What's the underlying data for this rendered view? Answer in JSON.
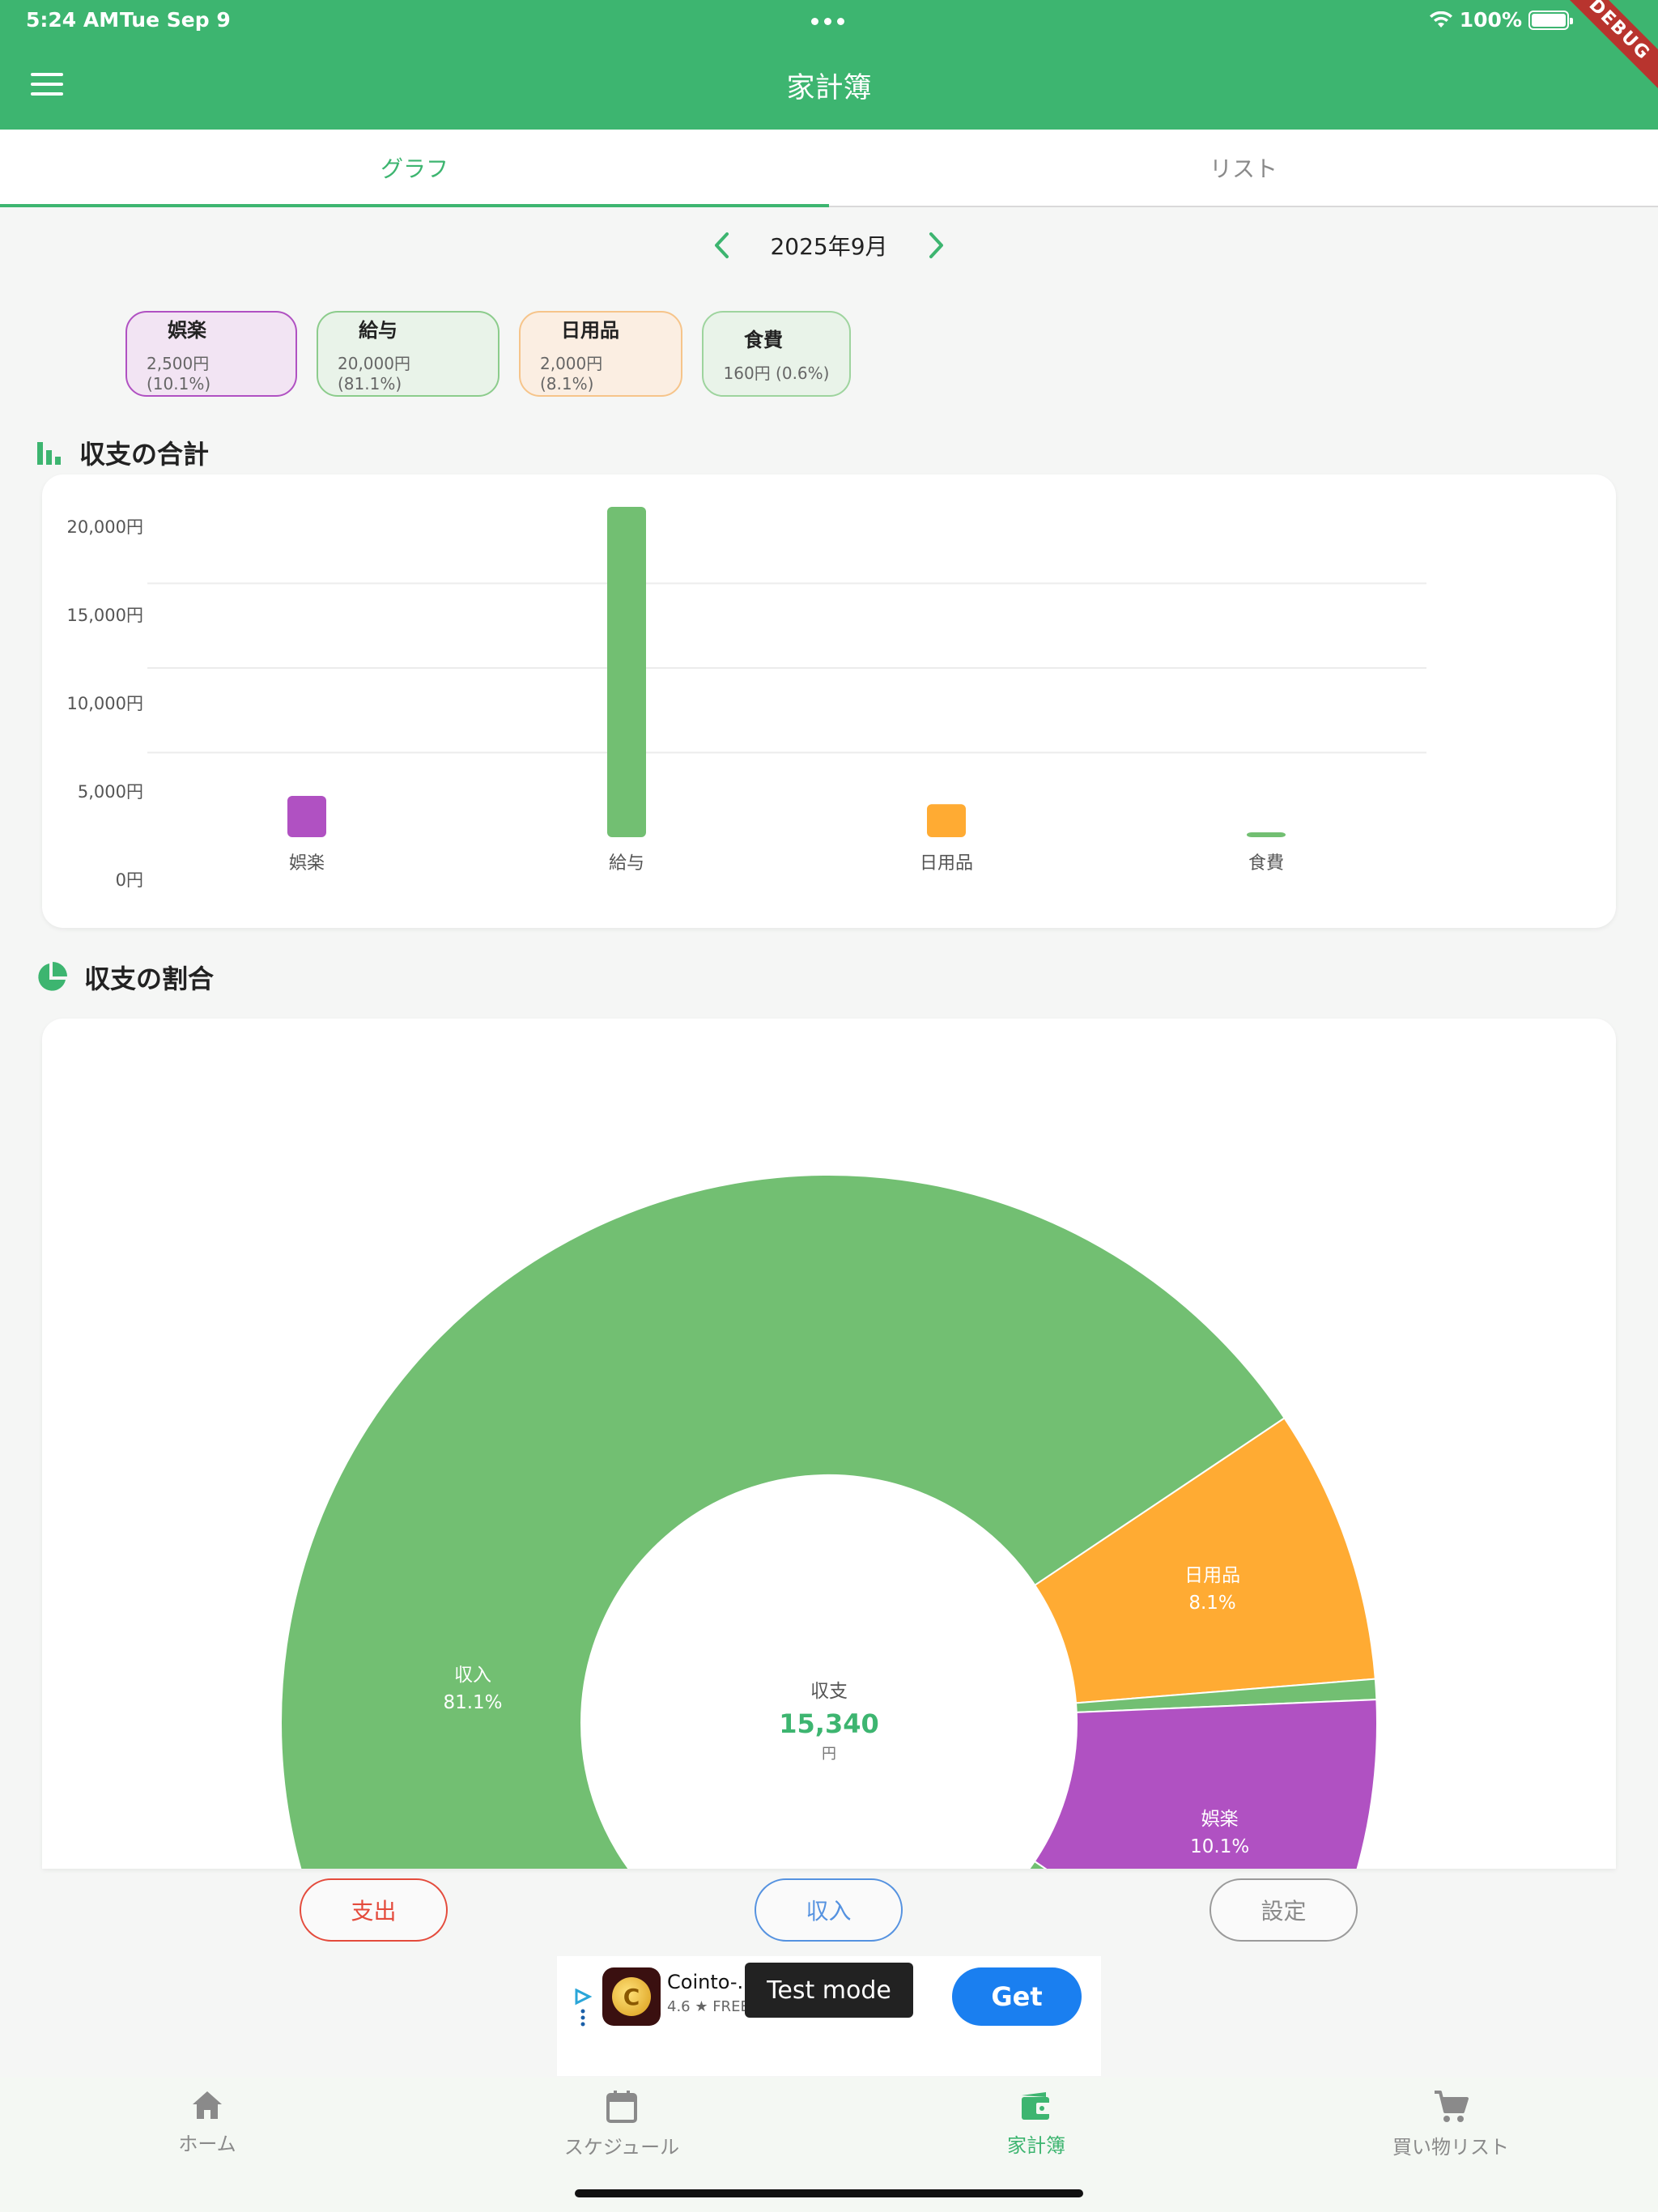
{
  "status_bar": {
    "time": "5:24 AM",
    "date": "Tue Sep 9",
    "battery": "100%",
    "ribbon": "DEBUG"
  },
  "app_bar": {
    "title": "家計簿"
  },
  "tabs": [
    {
      "label": "グラフ",
      "active": true
    },
    {
      "label": "リスト",
      "active": false
    }
  ],
  "month_nav": {
    "label": "2025年9月"
  },
  "chips": [
    {
      "name": "娯楽",
      "value": "2,500円 (10.1%)",
      "color": "#b051c2",
      "bg": "#f2e4f3"
    },
    {
      "name": "給与",
      "value": "20,000円 (81.1%)",
      "color": "#8ccc8c",
      "bg": "#e9f3e9"
    },
    {
      "name": "日用品",
      "value": "2,000円 (8.1%)",
      "color": "#f6c48a",
      "bg": "#fbeee2"
    },
    {
      "name": "食費",
      "value": "160円 (0.6%)",
      "color": "#9ed49e",
      "bg": "#e9f3e9"
    }
  ],
  "sections": {
    "totals": "収支の合計",
    "ratio": "収支の割合"
  },
  "chart_data": [
    {
      "type": "bar",
      "categories": [
        "娯楽",
        "給与",
        "日用品",
        "食費"
      ],
      "values": [
        2500,
        20000,
        2000,
        160
      ],
      "colors": [
        "#b051c2",
        "#72bf72",
        "#ffab33",
        "#72bf72"
      ],
      "y_ticks": [
        "0円",
        "5,000円",
        "10,000円",
        "15,000円",
        "20,000円"
      ],
      "ylim": [
        0,
        20000
      ],
      "grid": true
    },
    {
      "type": "pie",
      "style": "donut",
      "slices": [
        {
          "label": "日用品",
          "percent_label": "8.1%",
          "percent": 8.1,
          "color": "#ffab33"
        },
        {
          "label": "",
          "percent_label": "",
          "percent": 0.6,
          "color": "#72bf72"
        },
        {
          "label": "娯楽",
          "percent_label": "10.1%",
          "percent": 10.1,
          "color": "#b051c2"
        },
        {
          "label": "収入",
          "percent_label": "81.1%",
          "percent": 81.1,
          "color": "#72bf72"
        }
      ],
      "center": {
        "label": "収支",
        "value": "15,340",
        "unit": "円"
      }
    }
  ],
  "actions": {
    "expense": "支出",
    "income": "収入",
    "settings": "設定"
  },
  "ad": {
    "app_name": "Cointo-..",
    "rating": "4.6 ★ FREE",
    "badge": "Test mode",
    "cta": "Get"
  },
  "bottom_nav": [
    {
      "label": "ホーム",
      "icon": "home-icon",
      "active": false
    },
    {
      "label": "スケジュール",
      "icon": "calendar-icon",
      "active": false
    },
    {
      "label": "家計簿",
      "icon": "wallet-icon",
      "active": true
    },
    {
      "label": "買い物リスト",
      "icon": "cart-icon",
      "active": false
    }
  ]
}
